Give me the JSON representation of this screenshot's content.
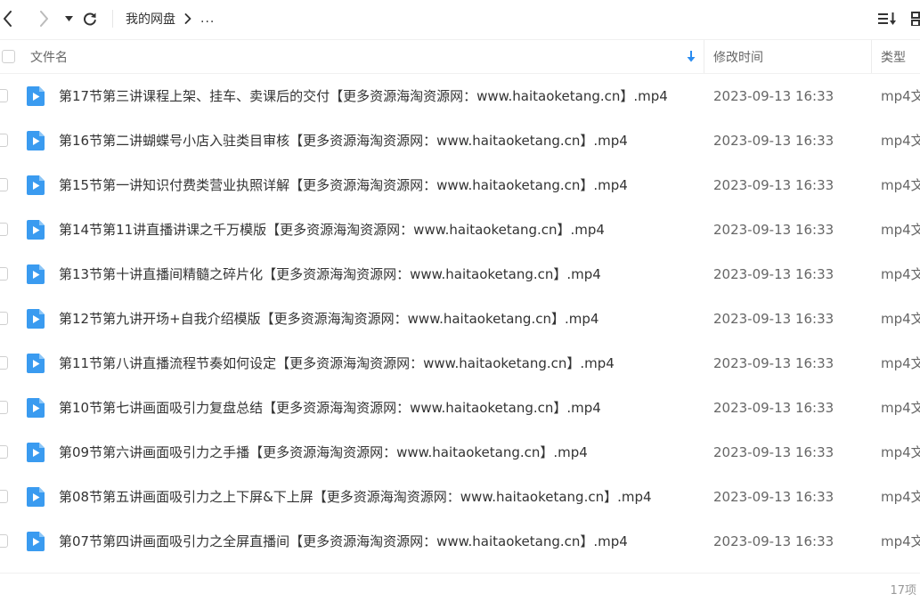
{
  "toolbar": {
    "back_icon": "chevron-left-icon",
    "forward_icon": "chevron-right-icon",
    "history_icon": "caret-down-icon",
    "refresh_icon": "refresh-icon",
    "breadcrumb": {
      "root": "我的网盘",
      "more": "..."
    },
    "sort_icon": "sort-icon",
    "grid_icon": "grid-view-icon"
  },
  "columns": {
    "name": "文件名",
    "modified": "修改时间",
    "type": "类型"
  },
  "sort_indicator_color": "#2a8cf0",
  "files": [
    {
      "name": "第17节第三讲课程上架、挂车、卖课后的交付【更多资源海淘资源网：www.haitaoketang.cn】.mp4",
      "modified": "2023-09-13 16:33",
      "type": "mp4文"
    },
    {
      "name": "第16节第二讲蝴蝶号小店入驻类目审核【更多资源海淘资源网：www.haitaoketang.cn】.mp4",
      "modified": "2023-09-13 16:33",
      "type": "mp4文"
    },
    {
      "name": "第15节第一讲知识付费类营业执照详解【更多资源海淘资源网：www.haitaoketang.cn】.mp4",
      "modified": "2023-09-13 16:33",
      "type": "mp4文"
    },
    {
      "name": "第14节第11讲直播讲课之千万模版【更多资源海淘资源网：www.haitaoketang.cn】.mp4",
      "modified": "2023-09-13 16:33",
      "type": "mp4文"
    },
    {
      "name": "第13节第十讲直播间精髓之碎片化【更多资源海淘资源网：www.haitaoketang.cn】.mp4",
      "modified": "2023-09-13 16:33",
      "type": "mp4文"
    },
    {
      "name": "第12节第九讲开场+自我介绍模版【更多资源海淘资源网：www.haitaoketang.cn】.mp4",
      "modified": "2023-09-13 16:33",
      "type": "mp4文"
    },
    {
      "name": "第11节第八讲直播流程节奏如何设定【更多资源海淘资源网：www.haitaoketang.cn】.mp4",
      "modified": "2023-09-13 16:33",
      "type": "mp4文"
    },
    {
      "name": "第10节第七讲画面吸引力复盘总结【更多资源海淘资源网：www.haitaoketang.cn】.mp4",
      "modified": "2023-09-13 16:33",
      "type": "mp4文"
    },
    {
      "name": "第09节第六讲画面吸引力之手播【更多资源海淘资源网：www.haitaoketang.cn】.mp4",
      "modified": "2023-09-13 16:33",
      "type": "mp4文"
    },
    {
      "name": "第08节第五讲画面吸引力之上下屏&下上屏【更多资源海淘资源网：www.haitaoketang.cn】.mp4",
      "modified": "2023-09-13 16:33",
      "type": "mp4文"
    },
    {
      "name": "第07节第四讲画面吸引力之全屏直播间【更多资源海淘资源网：www.haitaoketang.cn】.mp4",
      "modified": "2023-09-13 16:33",
      "type": "mp4文"
    }
  ],
  "file_icon": "video-file-icon",
  "file_icon_color": "#3a9bf0",
  "footer": {
    "count": "17项"
  }
}
